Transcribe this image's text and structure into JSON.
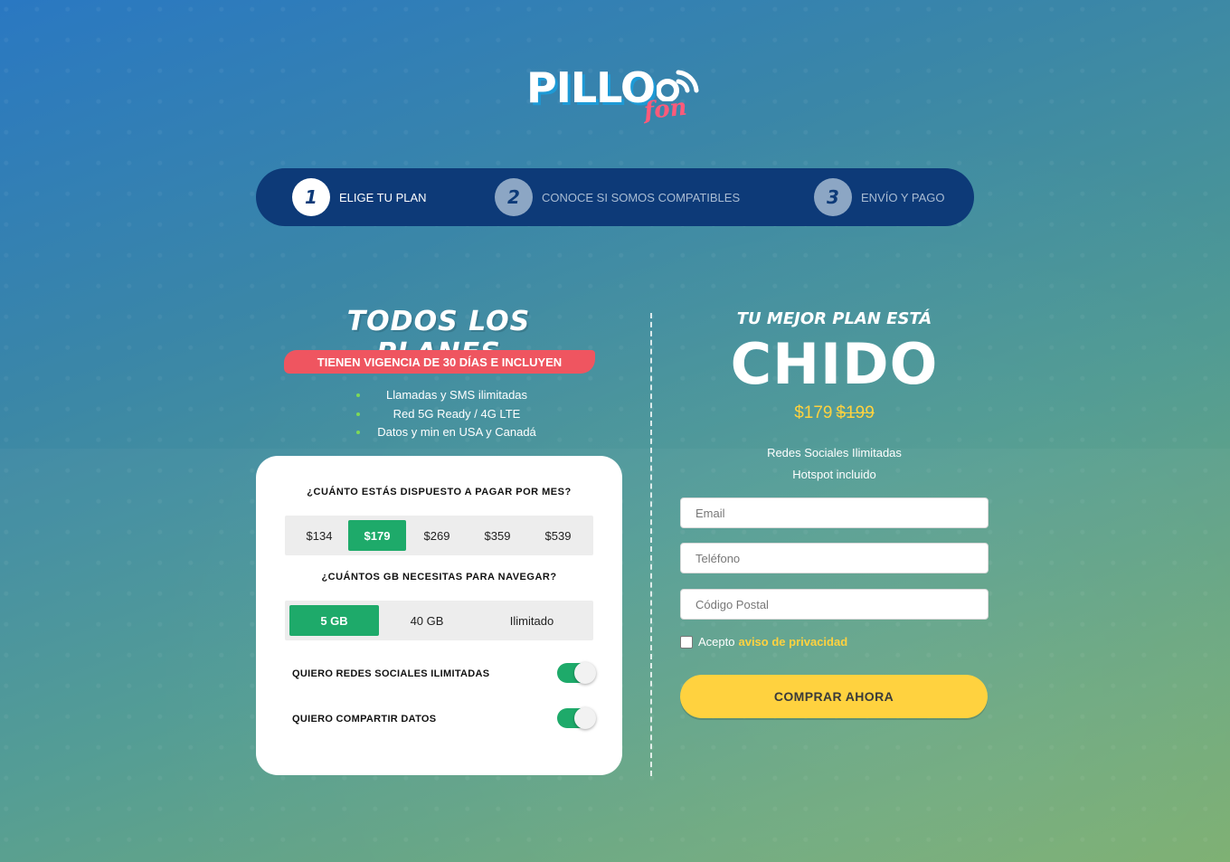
{
  "brand": {
    "logo_word": "PILLO",
    "logo_sub": "fon"
  },
  "stepper": [
    {
      "num": "1",
      "label": "ELIGE TU PLAN",
      "active": true
    },
    {
      "num": "2",
      "label": "CONOCE SI SOMOS COMPATIBLES",
      "active": false
    },
    {
      "num": "3",
      "label": "ENVÍO Y PAGO",
      "active": false
    }
  ],
  "left": {
    "title": "TODOS LOS PLANES",
    "banner": "TIENEN VIGENCIA DE 30 DÍAS E INCLUYEN",
    "features": [
      "Llamadas y SMS ilimitadas",
      "Red 5G Ready / 4G LTE",
      "Datos y min en USA y Canadá"
    ]
  },
  "card": {
    "price_question": "¿CUÁNTO ESTÁS DISPUESTO A PAGAR POR MES?",
    "price_options": [
      "$134",
      "$179",
      "$269",
      "$359",
      "$539"
    ],
    "price_selected": "$179",
    "gb_question": "¿CUÁNTOS GB NECESITAS PARA NAVEGAR?",
    "gb_options": [
      "5 GB",
      "40 GB",
      "Ilimitado"
    ],
    "gb_selected": "5 GB",
    "toggles": [
      {
        "label": "QUIERO REDES SOCIALES ILIMITADAS",
        "on": true
      },
      {
        "label": "QUIERO COMPARTIR DATOS",
        "on": true
      }
    ]
  },
  "right": {
    "script": "TU MEJOR PLAN ESTÁ",
    "headline": "CHIDO",
    "price_new": "$179",
    "price_old": "$199",
    "perks": [
      "Redes Sociales Ilimitadas",
      "Hotspot incluido"
    ],
    "fields": {
      "email": "Email",
      "phone": "Teléfono",
      "zip": "Código Postal"
    },
    "consent_text": "Acepto",
    "consent_link": "aviso de privacidad",
    "buy_label": "COMPRAR AHORA"
  },
  "colors": {
    "accent_green": "#1eaa6a",
    "accent_yellow": "#ffd23f",
    "banner_red": "#ef5560",
    "nav_blue": "#0d3a78"
  }
}
